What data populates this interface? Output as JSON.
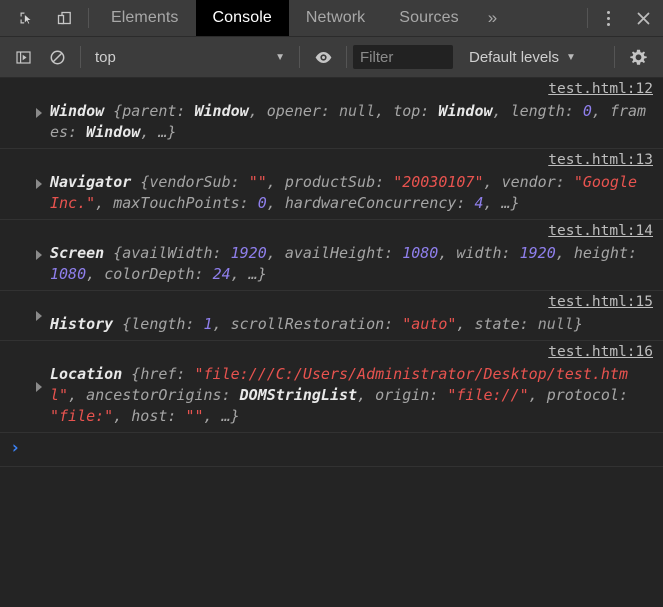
{
  "tabbar": {
    "icons": [
      {
        "name": "inspect-element-icon",
        "title": "Inspect element"
      },
      {
        "name": "device-toolbar-icon",
        "title": "Toggle device toolbar"
      }
    ],
    "tabs": [
      {
        "label": "Elements",
        "active": false
      },
      {
        "label": "Console",
        "active": true
      },
      {
        "label": "Network",
        "active": false
      },
      {
        "label": "Sources",
        "active": false
      }
    ],
    "more_tabs": "»",
    "kebab_title": "Customize and control DevTools",
    "close_title": "Close DevTools"
  },
  "toolbar": {
    "sidebar_toggle_title": "Show console sidebar",
    "clear_title": "Clear console",
    "context": "top",
    "context_caret": "▼",
    "eye_title": "Create live expression",
    "filter_placeholder": "Filter",
    "filter_value": "",
    "levels_label": "Default levels",
    "levels_caret": "▼",
    "settings_title": "Console settings"
  },
  "console": {
    "entries": [
      {
        "source": "test.html:12",
        "expandable": true,
        "parts": [
          {
            "t": "Window ",
            "c": "cls"
          },
          {
            "t": "{",
            "c": "punct"
          },
          {
            "t": "parent: ",
            "c": "key"
          },
          {
            "t": "Window",
            "c": "obj"
          },
          {
            "t": ", ",
            "c": "punct"
          },
          {
            "t": "opener: ",
            "c": "key"
          },
          {
            "t": "null",
            "c": "nul"
          },
          {
            "t": ", ",
            "c": "punct"
          },
          {
            "t": "top: ",
            "c": "key"
          },
          {
            "t": "Window",
            "c": "obj"
          },
          {
            "t": ", ",
            "c": "punct"
          },
          {
            "t": "length: ",
            "c": "key"
          },
          {
            "t": "0",
            "c": "num"
          },
          {
            "t": ", ",
            "c": "punct"
          },
          {
            "t": "frames: ",
            "c": "key"
          },
          {
            "t": "Window",
            "c": "obj"
          },
          {
            "t": ", …}",
            "c": "punct"
          }
        ]
      },
      {
        "source": "test.html:13",
        "expandable": true,
        "parts": [
          {
            "t": "Navigator ",
            "c": "cls"
          },
          {
            "t": "{",
            "c": "punct"
          },
          {
            "t": "vendorSub: ",
            "c": "key"
          },
          {
            "t": "\"\"",
            "c": "str"
          },
          {
            "t": ", ",
            "c": "punct"
          },
          {
            "t": "productSub: ",
            "c": "key"
          },
          {
            "t": "\"20030107\"",
            "c": "str"
          },
          {
            "t": ", ",
            "c": "punct"
          },
          {
            "t": "vendor: ",
            "c": "key"
          },
          {
            "t": "\"Google Inc.\"",
            "c": "str"
          },
          {
            "t": ", ",
            "c": "punct"
          },
          {
            "t": "maxTouchPoints: ",
            "c": "key"
          },
          {
            "t": "0",
            "c": "num"
          },
          {
            "t": ", ",
            "c": "punct"
          },
          {
            "t": "hardwareConcurrency: ",
            "c": "key"
          },
          {
            "t": "4",
            "c": "num"
          },
          {
            "t": ", …}",
            "c": "punct"
          }
        ]
      },
      {
        "source": "test.html:14",
        "expandable": true,
        "parts": [
          {
            "t": "Screen ",
            "c": "cls"
          },
          {
            "t": "{",
            "c": "punct"
          },
          {
            "t": "availWidth: ",
            "c": "key"
          },
          {
            "t": "1920",
            "c": "num"
          },
          {
            "t": ", ",
            "c": "punct"
          },
          {
            "t": "availHeight: ",
            "c": "key"
          },
          {
            "t": "1080",
            "c": "num"
          },
          {
            "t": ", ",
            "c": "punct"
          },
          {
            "t": "width: ",
            "c": "key"
          },
          {
            "t": "1920",
            "c": "num"
          },
          {
            "t": ", ",
            "c": "punct"
          },
          {
            "t": "height: ",
            "c": "key"
          },
          {
            "t": "1080",
            "c": "num"
          },
          {
            "t": ", ",
            "c": "punct"
          },
          {
            "t": "colorDepth: ",
            "c": "key"
          },
          {
            "t": "24",
            "c": "num"
          },
          {
            "t": ", …}",
            "c": "punct"
          }
        ]
      },
      {
        "source": "test.html:15",
        "expandable": true,
        "parts": [
          {
            "t": "History ",
            "c": "cls"
          },
          {
            "t": "{",
            "c": "punct"
          },
          {
            "t": "length: ",
            "c": "key"
          },
          {
            "t": "1",
            "c": "num"
          },
          {
            "t": ", ",
            "c": "punct"
          },
          {
            "t": "scrollRestoration: ",
            "c": "key"
          },
          {
            "t": "\"auto\"",
            "c": "str"
          },
          {
            "t": ", ",
            "c": "punct"
          },
          {
            "t": "state: ",
            "c": "key"
          },
          {
            "t": "null",
            "c": "nul"
          },
          {
            "t": "}",
            "c": "punct"
          }
        ]
      },
      {
        "source": "test.html:16",
        "expandable": true,
        "parts": [
          {
            "t": "Location ",
            "c": "cls"
          },
          {
            "t": "{",
            "c": "punct"
          },
          {
            "t": "href: ",
            "c": "key"
          },
          {
            "t": "\"file:///C:/Users/Administrator/Desktop/test.html\"",
            "c": "str"
          },
          {
            "t": ", ",
            "c": "punct"
          },
          {
            "t": "ancestorOrigins: ",
            "c": "key"
          },
          {
            "t": "DOMStringList",
            "c": "obj"
          },
          {
            "t": ", ",
            "c": "punct"
          },
          {
            "t": "origin: ",
            "c": "key"
          },
          {
            "t": "\"file://\"",
            "c": "str"
          },
          {
            "t": ", ",
            "c": "punct"
          },
          {
            "t": "protocol: ",
            "c": "key"
          },
          {
            "t": "\"file:\"",
            "c": "str"
          },
          {
            "t": ", ",
            "c": "punct"
          },
          {
            "t": "host: ",
            "c": "key"
          },
          {
            "t": "\"\"",
            "c": "str"
          },
          {
            "t": ", …}",
            "c": "punct"
          }
        ]
      }
    ]
  },
  "prompt": {
    "chevron": "›",
    "value": ""
  },
  "colors": {
    "background": "#242424",
    "toolbar": "#3c3c3c",
    "active_tab_bg": "#000000",
    "string": "#e8534f",
    "number": "#8f7fec",
    "prompt": "#3b82f6",
    "link": "#bdbdbd",
    "text": "#a5a5a5"
  }
}
